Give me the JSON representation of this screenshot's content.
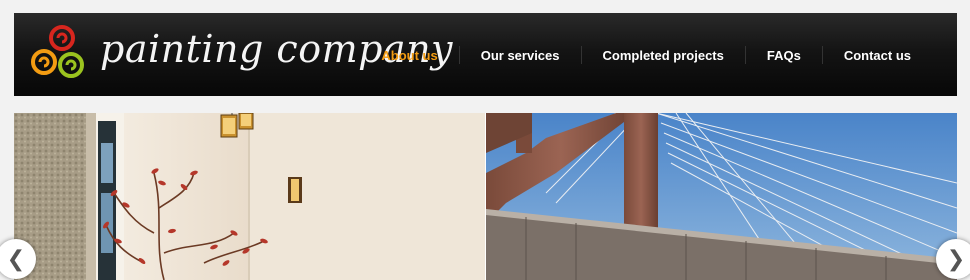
{
  "brand": {
    "name": "painting company",
    "logo_icon": "spiral-logo-icon",
    "logo_colors": [
      "#d7261e",
      "#f39c12",
      "#9bc31f"
    ]
  },
  "nav": {
    "items": [
      {
        "label": "About us",
        "active": true
      },
      {
        "label": "Our services",
        "active": false
      },
      {
        "label": "Completed projects",
        "active": false
      },
      {
        "label": "FAQs",
        "active": false
      },
      {
        "label": "Contact us",
        "active": false
      }
    ],
    "active_color": "#f39c12"
  },
  "slider": {
    "slides": [
      {
        "image": "interior-room-with-red-branch-plant"
      },
      {
        "image": "cable-stayed-bridge-tower"
      }
    ],
    "prev_icon": "chevron-left-icon",
    "next_icon": "chevron-right-icon",
    "prev_glyph": "❮",
    "next_glyph": "❯"
  }
}
